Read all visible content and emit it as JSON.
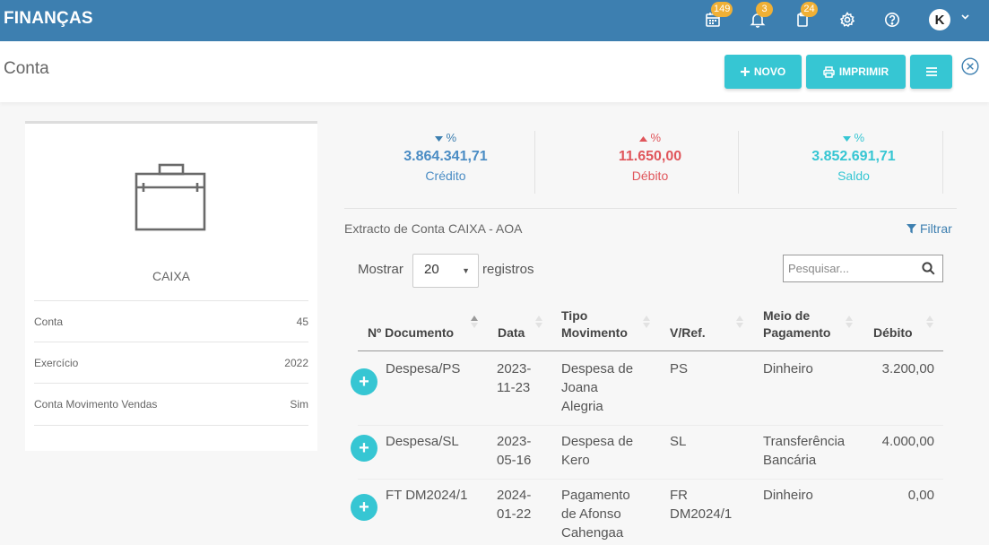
{
  "app": {
    "brand": "FINANÇAS"
  },
  "topbar": {
    "badges": {
      "calendar": "149",
      "bell": "3",
      "clipboard": "24"
    },
    "avatar_letter": "K"
  },
  "page": {
    "title": "Conta"
  },
  "actions": {
    "novo": "NOVO",
    "imprimir": "IMPRIMIR"
  },
  "account": {
    "name": "CAIXA",
    "fields": [
      {
        "label": "Conta",
        "value": "45"
      },
      {
        "label": "Exercício",
        "value": "2022"
      },
      {
        "label": "Conta Movimento Vendas",
        "value": "Sim"
      }
    ]
  },
  "stats": {
    "credito": {
      "pct": "%",
      "value": "3.864.341,71",
      "label": "Crédito",
      "color": "#3d7fb0"
    },
    "debito": {
      "pct": "%",
      "value": "11.650,00",
      "label": "Débito",
      "color": "#e0565b"
    },
    "saldo": {
      "pct": "%",
      "value": "3.852.691,71",
      "label": "Saldo",
      "color": "#36c6d3"
    }
  },
  "extract": {
    "title": "Extracto de Conta CAIXA - AOA",
    "filter_label": "Filtrar",
    "show_label": "Mostrar",
    "page_size": "20",
    "records_label": "registros",
    "search_placeholder": "Pesquisar..."
  },
  "table": {
    "headers": {
      "documento": "Nº Documento",
      "data": "Data",
      "tipo_l1": "Tipo",
      "tipo_l2": "Movimento",
      "vref": "V/Ref.",
      "meio_l1": "Meio de",
      "meio_l2": "Pagamento",
      "debito": "Débito"
    },
    "rows": [
      {
        "documento": "Despesa/PS",
        "data": [
          "2023-",
          "11-23"
        ],
        "tipo": [
          "Despesa de",
          "Joana",
          "Alegria"
        ],
        "vref": [
          "PS"
        ],
        "meio": [
          "Dinheiro"
        ],
        "debito": "3.200,00"
      },
      {
        "documento": "Despesa/SL",
        "data": [
          "2023-",
          "05-16"
        ],
        "tipo": [
          "Despesa de",
          "Kero"
        ],
        "vref": [
          "SL"
        ],
        "meio": [
          "Transferência",
          "Bancária"
        ],
        "debito": "4.000,00"
      },
      {
        "documento": "FT DM2024/1",
        "data": [
          "2024-",
          "01-22"
        ],
        "tipo": [
          "Pagamento",
          "de Afonso",
          "Cahengaa"
        ],
        "vref": [
          "FR",
          "DM2024/1"
        ],
        "meio": [
          "Dinheiro"
        ],
        "debito": "0,00"
      }
    ]
  }
}
